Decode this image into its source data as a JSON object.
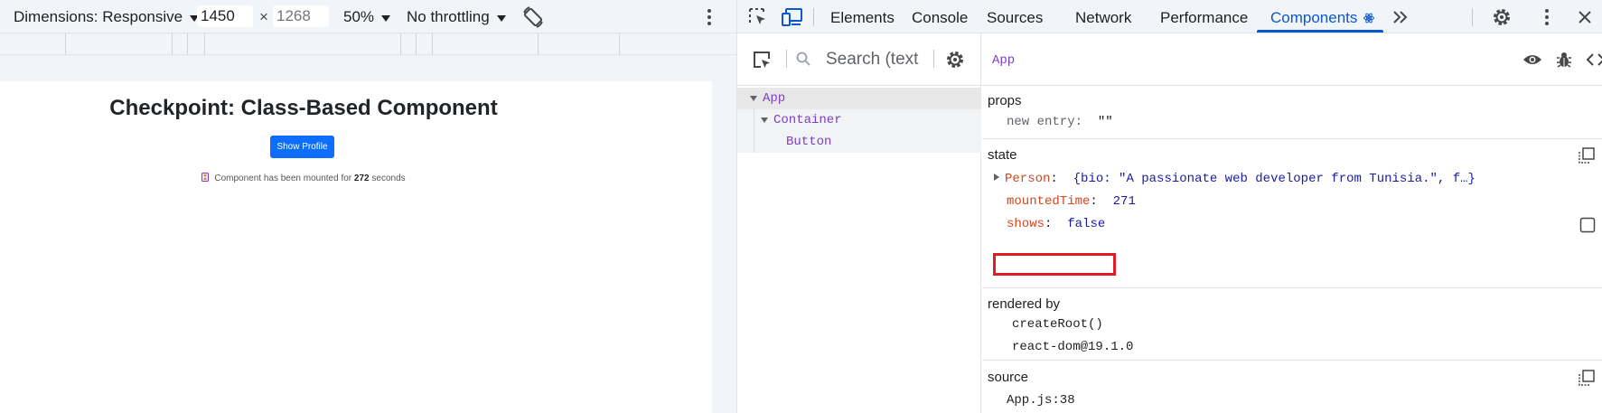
{
  "device_toolbar": {
    "dimensions_label": "Dimensions: Responsive",
    "width_value": "1450",
    "times": "×",
    "height_placeholder": "1268",
    "zoom": "50%",
    "throttling": "No throttling"
  },
  "page": {
    "heading": "Checkpoint: Class-Based Component",
    "button_label": "Show Profile",
    "mounted_prefix": "Component has been mounted for",
    "mounted_seconds": "272",
    "mounted_suffix": "seconds"
  },
  "devtools": {
    "tabs": [
      "Elements",
      "Console",
      "Sources",
      "Network",
      "Performance",
      "Components"
    ],
    "active_tab": "Components",
    "search_placeholder": "Search (text",
    "tree": [
      {
        "label": "App",
        "depth": 0,
        "expanded": true,
        "selected": true
      },
      {
        "label": "Container",
        "depth": 1,
        "expanded": true,
        "selected": false
      },
      {
        "label": "Button",
        "depth": 2,
        "expanded": false,
        "selected": false
      }
    ],
    "component_name": "App",
    "props_title": "props",
    "props": [
      {
        "key": "new entry",
        "value": "\"\""
      }
    ],
    "state_title": "state",
    "state": {
      "person_key": "Person",
      "person_value": "{bio: \"A passionate web developer from Tunisia.\", f…}",
      "mounted_key": "mountedTime",
      "mounted_value": "271",
      "shows_key": "shows",
      "shows_value": "false"
    },
    "rendered_by_title": "rendered by",
    "rendered_by": [
      "createRoot()",
      "react-dom@19.1.0"
    ],
    "source_title": "source",
    "source_value": "App.js:38"
  },
  "colors": {
    "accent": "#0b57d0",
    "button": "#0d6efd",
    "highlight_box": "#e01b24",
    "component_purple": "#7b3fbf",
    "key_orange": "#d0471e",
    "value_blue": "#1a1aa6"
  }
}
